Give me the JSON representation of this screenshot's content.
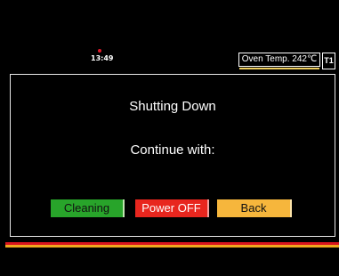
{
  "status": {
    "time": "13:49",
    "oven_temp": "Oven Temp. 242℃",
    "tray": "T1"
  },
  "dialog": {
    "title": "Shutting Down",
    "subtitle": "Continue with:",
    "buttons": {
      "cleaning": "Cleaning",
      "power_off": "Power OFF",
      "back": "Back"
    }
  },
  "colors": {
    "cleaning": "#28a42a",
    "power_off": "#e8261e",
    "back": "#f6b63c",
    "alert_dot": "#e0192a"
  }
}
